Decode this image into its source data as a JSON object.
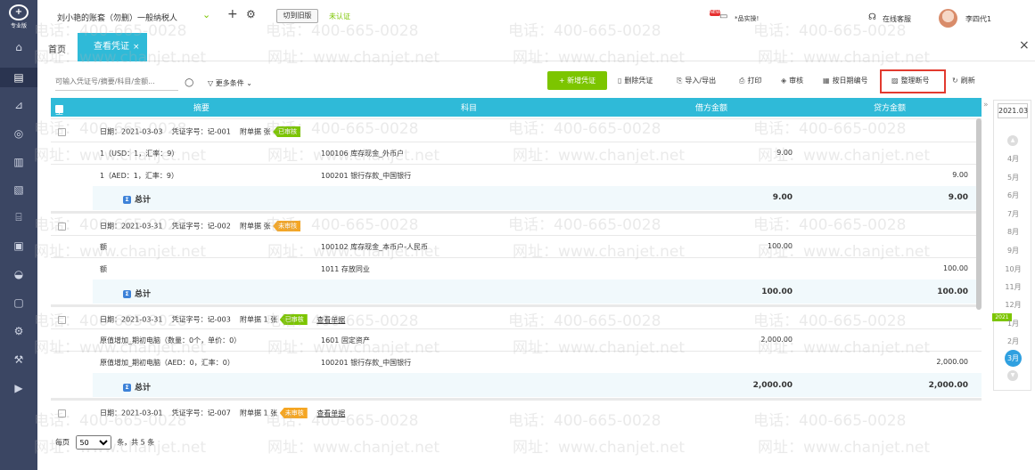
{
  "app": {
    "logo_label": "专业版"
  },
  "topbar": {
    "account_name": "刘小艳的账套（勿删）一般纳税人",
    "switch_old_label": "切到旧版",
    "unverified_label": "未认证",
    "promo_badge": "NEW",
    "promo_label": "*品实操!",
    "help_label": "在线客服",
    "user_name": "李四代1"
  },
  "tabs": {
    "home": "首页",
    "active": "查看凭证",
    "close": "×"
  },
  "filters": {
    "search_placeholder": "可输入凭证号/摘要/科目/金额...",
    "more_label": "更多条件"
  },
  "toolbar": {
    "new_voucher": "+ 新增凭证",
    "delete": "删除凭证",
    "import_export": "导入/导出",
    "print": "打印",
    "audit": "审核",
    "date_number": "按日期编号",
    "renumber": "整理断号",
    "refresh": "刷新"
  },
  "table": {
    "headers": {
      "select_all": "全选",
      "summary": "摘要",
      "subject": "科目",
      "debit": "借方金额",
      "credit": "贷方金额"
    },
    "total_label": "总计",
    "vouchers": [
      {
        "date": "日期：2021-03-03",
        "number": "凭证字号：记-001",
        "attach": "附单据 张",
        "status": "已审核",
        "status_color": "#7cc500",
        "view": "",
        "lines": [
          {
            "summary": "1（USD：1，汇率：9）",
            "subject": "100106 库存现金_外币户",
            "debit": "9.00",
            "credit": ""
          },
          {
            "summary": "1（AED：1，汇率：9）",
            "subject": "100201 银行存款_中国银行",
            "debit": "",
            "credit": "9.00"
          }
        ],
        "total_debit": "9.00",
        "total_credit": "9.00"
      },
      {
        "date": "日期：2021-03-31",
        "number": "凭证字号：记-002",
        "attach": "附单据 张",
        "status": "未审核",
        "status_color": "#f5a623",
        "view": "",
        "lines": [
          {
            "summary": "额",
            "subject": "100102 库存现金_本币户-人民币",
            "debit": "100.00",
            "credit": ""
          },
          {
            "summary": "额",
            "subject": "1011 存放同业",
            "debit": "",
            "credit": "100.00"
          }
        ],
        "total_debit": "100.00",
        "total_credit": "100.00"
      },
      {
        "date": "日期：2021-03-31",
        "number": "凭证字号：记-003",
        "attach": "附单据 1 张",
        "status": "已审核",
        "status_color": "#7cc500",
        "view": "查看单据",
        "lines": [
          {
            "summary": "原值增加_期初电脑（数量：0个，单价：0）",
            "subject": "1601 固定资产",
            "debit": "2,000.00",
            "credit": ""
          },
          {
            "summary": "原值增加_期初电脑（AED：0，汇率：0）",
            "subject": "100201 银行存款_中国银行",
            "debit": "",
            "credit": "2,000.00"
          }
        ],
        "total_debit": "2,000.00",
        "total_credit": "2,000.00"
      },
      {
        "date": "日期：2021-03-01",
        "number": "凭证字号：记-007",
        "attach": "附单据 1 张",
        "status": "未审核",
        "status_color": "#f5a623",
        "view": "查看单据",
        "lines": [],
        "total_debit": "",
        "total_credit": ""
      }
    ]
  },
  "pager": {
    "per_page_label": "每页",
    "per_page_value": "50",
    "total_label": "条，共 5 条"
  },
  "months": {
    "year": "2021.03",
    "year_mark": "2021",
    "items": [
      "4月",
      "5月",
      "6月",
      "7月",
      "8月",
      "9月",
      "10月",
      "11月",
      "12月",
      "1月",
      "2月",
      "3月"
    ],
    "current": "3月"
  },
  "watermark": {
    "phone": "电话：400-665-0028",
    "site": "网址：www.chanjet.net"
  }
}
